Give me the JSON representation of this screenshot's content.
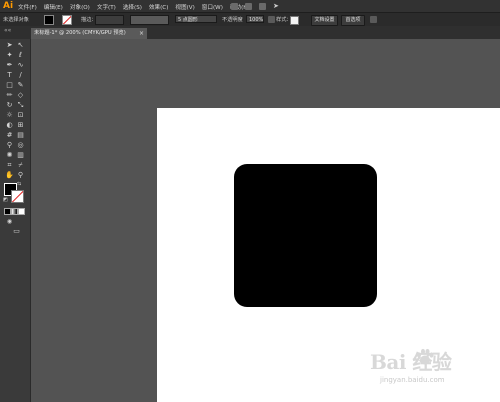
{
  "app": {
    "logo": "Ai"
  },
  "menu": [
    "文件(F)",
    "编辑(E)",
    "对象(O)",
    "文字(T)",
    "选择(S)",
    "效果(C)",
    "视图(V)",
    "窗口(W)",
    "帮助(H)"
  ],
  "control_bar": {
    "selection_label": "未选择对象",
    "stroke_label": "描边：",
    "brush_label": "5 点圆形",
    "opacity_label": "不透明度",
    "opacity_value": "100%",
    "style_label": "样式：",
    "doc_setup_button": "文档设置",
    "prefs_button": "首选项"
  },
  "document_tab": {
    "title": "未标题-1* @ 200% (CMYK/GPU 预览)",
    "close": "×"
  },
  "toolbar": {
    "collapse": "««",
    "tools": [
      "selection-tool",
      "direct-selection-tool",
      "magic-wand-tool",
      "lasso-tool",
      "pen-tool",
      "curvature-tool",
      "type-tool",
      "line-tool",
      "rectangle-tool",
      "paintbrush-tool",
      "pencil-tool",
      "eraser-tool",
      "rotate-tool",
      "scale-tool",
      "warp-tool",
      "free-transform-tool",
      "shape-builder-tool",
      "perspective-grid-tool",
      "mesh-tool",
      "gradient-tool",
      "eyedropper-tool",
      "blend-tool",
      "symbol-sprayer-tool",
      "column-graph-tool",
      "artboard-tool",
      "slice-tool",
      "hand-tool",
      "zoom-tool"
    ]
  },
  "colors": {
    "menubar": "#323232",
    "workspace": "#535353",
    "artboard": "#ffffff",
    "shape_fill": "#000000",
    "logo": "#ff9a00"
  },
  "watermark": {
    "text": "Bai 经验",
    "url": "jingyan.baidu.com"
  }
}
